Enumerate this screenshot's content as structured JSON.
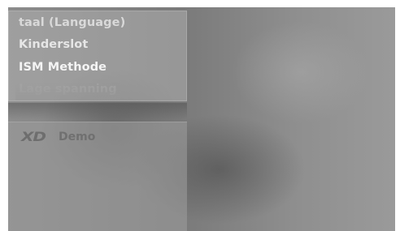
{
  "menu": {
    "items": [
      {
        "label": "taal (Language)"
      },
      {
        "label": "Kinderslot"
      },
      {
        "label": "ISM Methode"
      },
      {
        "label": "Lage spanning"
      }
    ]
  },
  "xd_panel": {
    "logo_text": "XD",
    "label": "Demo"
  }
}
